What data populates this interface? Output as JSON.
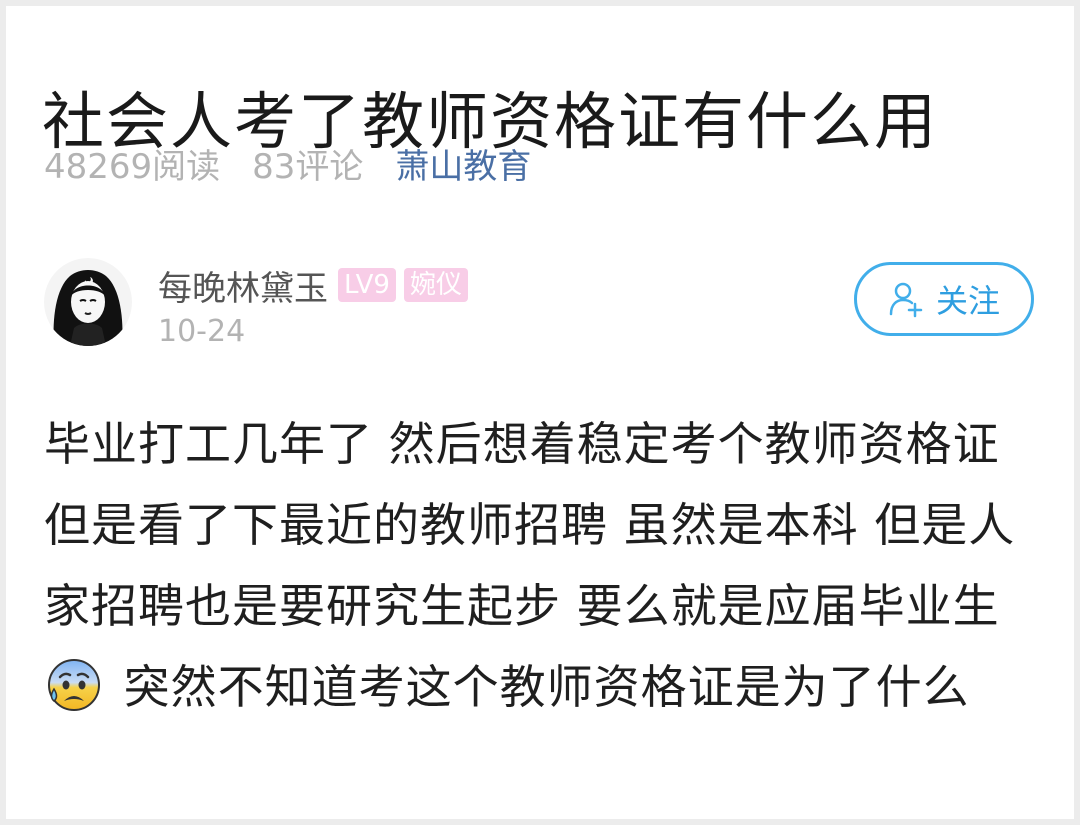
{
  "article": {
    "title": "社会人考了教师资格证有什么用",
    "reads": "48269阅读",
    "comments": "83评论",
    "source": "萧山教育"
  },
  "author": {
    "name": "每晚林黛玉",
    "level_badge": "LV9",
    "title_badge": "婉仪",
    "date": "10-24",
    "follow_label": "关注"
  },
  "post": {
    "text_before_emoji": "毕业打工几年了 然后想着稳定考个教师资格证 但是看了下最近的教师招聘 虽然是本科 但是人家招聘也是要研究生起步 要么就是应届毕业生",
    "emoji": "anxious-face-with-sweat-emoji",
    "text_after_emoji": " 突然不知道考这个教师资格证是为了什么"
  },
  "colors": {
    "source_link": "#4a6fa5",
    "follow_accent": "#41aeea",
    "badge_pink": "#f8cde7",
    "meta_gray": "#b3b3b3"
  }
}
